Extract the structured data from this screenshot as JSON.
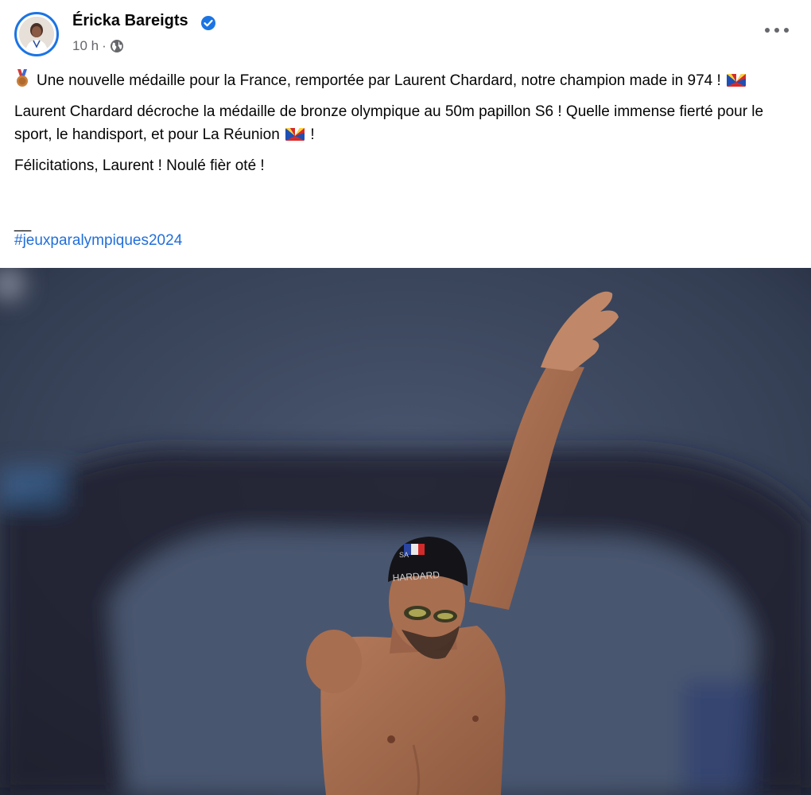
{
  "post": {
    "author": "Éricka Bareigts",
    "time": "10 h",
    "separator": "·",
    "paragraph1_a": "Une nouvelle médaille pour la France, remportée par Laurent Chardard, notre champion made in 974 !",
    "paragraph2_a": "Laurent Chardard décroche la médaille de bronze olympique au 50m papillon S6 ! Quelle immense fierté pour le sport, le handisport, et pour La Réunion",
    "paragraph2_b": "!",
    "paragraph3": "Félicitations, Laurent ! Noulé fièr oté !",
    "dash": "__",
    "hashtag": "#jeuxparalympiques2024",
    "cap_text": "HARDARD",
    "cap_code": "SA"
  },
  "icons": {
    "verified": "verified-badge-icon",
    "privacy": "globe-icon",
    "more": "more-options-icon",
    "medal": "bronze-medal-emoji",
    "flag": "reunion-flag-emoji"
  },
  "colors": {
    "accent": "#1b74e4",
    "link": "#216fdb",
    "secondary_text": "#65676b"
  }
}
